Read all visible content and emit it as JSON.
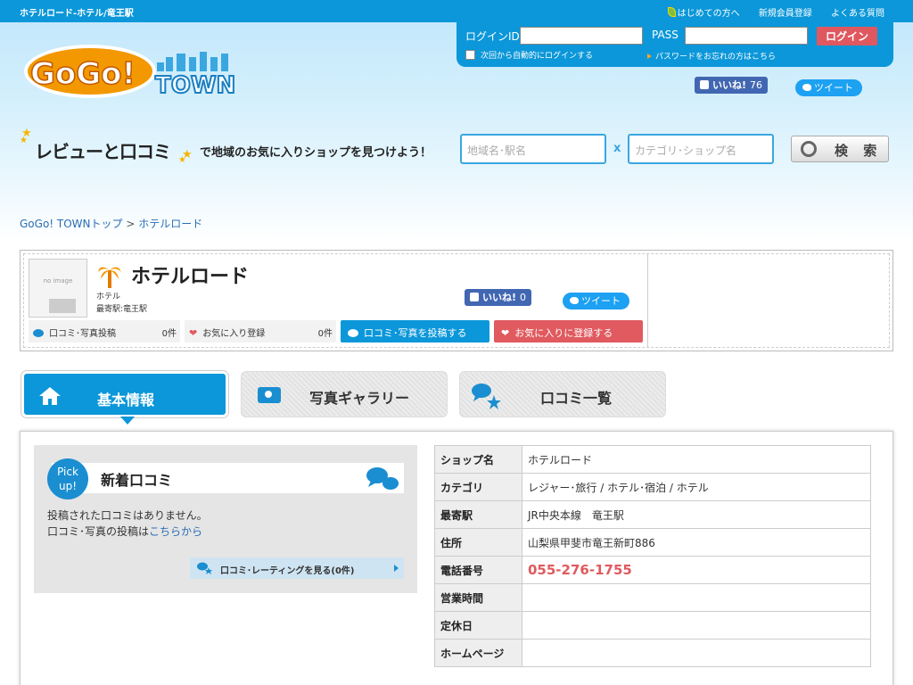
{
  "header": {
    "site_title": "ホテルロード-ホテル/竜王駅",
    "links": [
      "はじめての方へ",
      "新規会員登録",
      "よくある質問"
    ]
  },
  "login": {
    "id_label": "ログインID",
    "pass_label": "PASS",
    "button": "ログイン",
    "auto_login": "次回から自動的にログインする",
    "forgot": "パスワードをお忘れの方はこちら"
  },
  "social_top": {
    "like_label": "いいね!",
    "like_count": "76",
    "tweet": "ツイート"
  },
  "logo": {
    "text1": "GoGo!",
    "text2": "TOWN"
  },
  "tagline": {
    "part1": "レビューと口コミ",
    "part2": "で地域のお気に入りショップを見つけよう！"
  },
  "search": {
    "area_placeholder": "地域名･駅名",
    "x": "x",
    "cat_placeholder": "カテゴリ･ショップ名",
    "button": "検 索"
  },
  "breadcrumb": {
    "home": "GoGo! TOWNトップ",
    "sep": ">",
    "current": "ホテルロード"
  },
  "shop": {
    "no_image": "no image",
    "name": "ホテルロード",
    "category": "ホテル",
    "station": "最寄駅:竜王駅",
    "like_label": "いいね!",
    "like_count": "0",
    "tweet": "ツイート",
    "review_count_label": "口コミ･写真投稿",
    "review_count": "0件",
    "fav_count_label": "お気に入り登録",
    "fav_count": "0件",
    "post_button": "口コミ･写真を投稿する",
    "fav_button": "お気に入りに登録する"
  },
  "tabs": [
    {
      "label": "基本情報",
      "active": true
    },
    {
      "label": "写真ギャラリー",
      "active": false
    },
    {
      "label": "口コミ一覧",
      "active": false
    }
  ],
  "pickup": {
    "badge": "Pick up!",
    "title": "新着口コミ",
    "empty": "投稿された口コミはありません。",
    "post_prefix": "口コミ･写真の投稿は",
    "post_link": "こちらから",
    "more": "口コミ･レーティングを見る(0件)"
  },
  "info": {
    "rows": [
      {
        "label": "ショップ名",
        "value": "ホテルロード"
      },
      {
        "label": "カテゴリ",
        "value": "レジャー･旅行 / ホテル･宿泊 / ホテル"
      },
      {
        "label": "最寄駅",
        "value": "JR中央本線　竜王駅"
      },
      {
        "label": "住所",
        "value": "山梨県甲斐市竜王新町886"
      },
      {
        "label": "電話番号",
        "value": "055-276-1755"
      },
      {
        "label": "営業時間",
        "value": ""
      },
      {
        "label": "定休日",
        "value": ""
      },
      {
        "label": "ホームページ",
        "value": ""
      }
    ]
  },
  "colors": {
    "primary": "#0b97d9",
    "accent": "#e05a5f",
    "link": "#2a6db5"
  }
}
